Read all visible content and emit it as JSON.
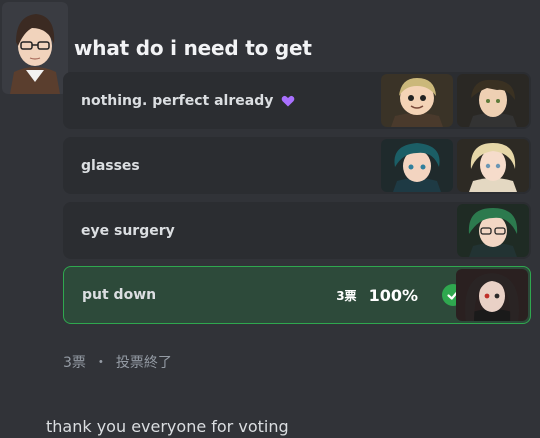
{
  "poll": {
    "question": "what do i need to get",
    "answers": [
      {
        "label": "nothing. perfect already",
        "emoji": "purple-heart-emoji",
        "selected": false
      },
      {
        "label": "glasses",
        "selected": false
      },
      {
        "label": "eye surgery",
        "selected": false
      },
      {
        "label": "put down",
        "selected": true,
        "votes": "3票",
        "percent": "100%"
      }
    ],
    "footer": {
      "total": "3票",
      "separator": "・",
      "status": "投票終了"
    }
  },
  "message": "thank you everyone for voting",
  "colors": {
    "background": "#313338",
    "answer_bg": "#2b2d31",
    "selected_bg": "#2d4a3a",
    "selected_border": "#2fa84f",
    "check": "#2fa84f",
    "heart": "#a970ff"
  }
}
